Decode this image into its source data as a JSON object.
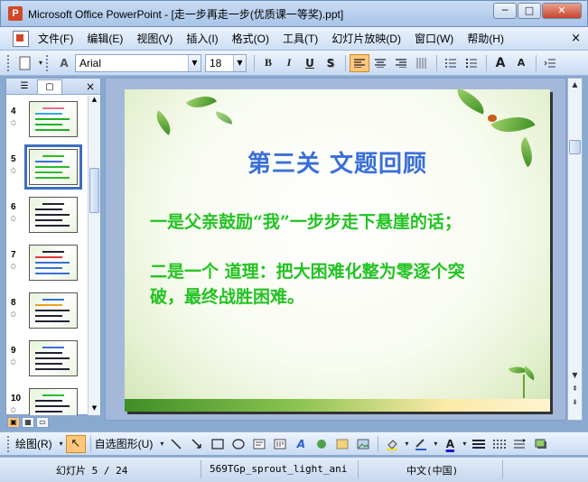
{
  "window": {
    "title": "Microsoft Office PowerPoint - [走一步再走一步(优质课一等奖).ppt]",
    "minimize": "─",
    "maximize": "□",
    "close": "✕"
  },
  "menu": [
    "文件(F)",
    "编辑(E)",
    "视图(V)",
    "插入(I)",
    "格式(O)",
    "工具(T)",
    "幻灯片放映(D)",
    "窗口(W)",
    "帮助(H)"
  ],
  "menu_close": "×",
  "toolbar": {
    "font_name": "Arial",
    "font_size": "18",
    "bold": "B",
    "italic": "I",
    "underline": "U",
    "shadow": "S",
    "grow_font": "A",
    "shrink_font": "A"
  },
  "pane": {
    "tab_outline": "☰",
    "tab_slides": "▢",
    "close": "×",
    "thumbnails": [
      {
        "num": "4",
        "star": "✩"
      },
      {
        "num": "5",
        "star": "✩"
      },
      {
        "num": "6",
        "star": "✩"
      },
      {
        "num": "7",
        "star": "✩"
      },
      {
        "num": "8",
        "star": "✩"
      },
      {
        "num": "9",
        "star": "✩"
      },
      {
        "num": "10",
        "star": "✩"
      }
    ],
    "selected_index": 1
  },
  "slide": {
    "title": "第三关  文题回顾",
    "line1": "一是父亲鼓励“我”一步步走下悬崖的话；",
    "line2a": "二是一个 道理：把大困难化整为零逐个突",
    "line2b": "破，最终战胜困难。"
  },
  "drawbar": {
    "draw": "绘图(R)",
    "autoshapes": "自选图形(U)"
  },
  "status": {
    "slide_pos": "幻灯片 5 / 24",
    "design": "569TGp_sprout_light_ani",
    "language": "中文(中国)"
  },
  "colors": {
    "title_blue": "#3a6fd8",
    "body_green": "#22c322"
  }
}
